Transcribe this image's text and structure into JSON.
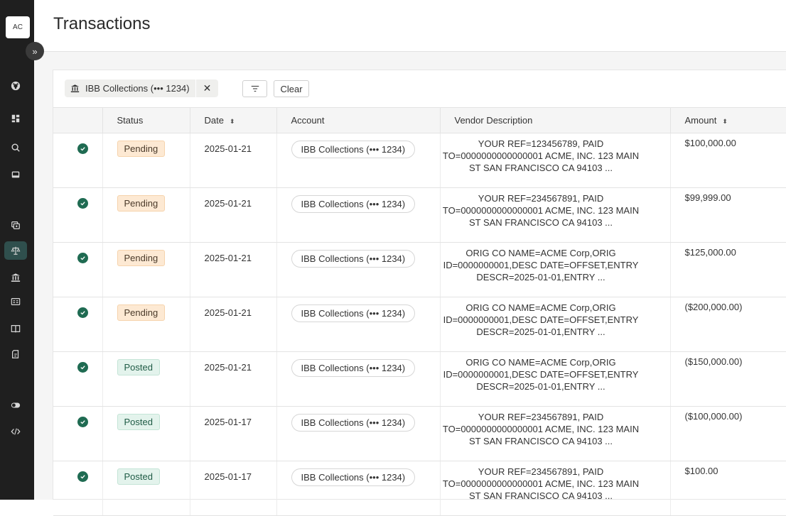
{
  "sidebar": {
    "avatar_initials": "AC",
    "expand_glyph": "»",
    "items": [
      {
        "icon": "life-ring-icon"
      },
      {
        "icon": "dashboard-icon"
      },
      {
        "icon": "search-icon"
      },
      {
        "icon": "inbox-icon"
      },
      {
        "icon": "accounts-icon"
      },
      {
        "icon": "scales-icon",
        "active": true
      },
      {
        "icon": "bank-icon"
      },
      {
        "icon": "id-card-icon"
      },
      {
        "icon": "book-icon"
      },
      {
        "icon": "document-icon"
      },
      {
        "icon": "toggle-icon"
      },
      {
        "icon": "code-icon"
      }
    ]
  },
  "header": {
    "title": "Transactions"
  },
  "filters": {
    "chip_label": "IBB Collections (••• 1234)",
    "chip_close": "✕",
    "clear_label": "Clear"
  },
  "table": {
    "columns": [
      "",
      "Status",
      "Date",
      "Account",
      "Vendor Description",
      "Amount"
    ],
    "sort_glyph": "⬍",
    "rows": [
      {
        "status": "Pending",
        "date": "2025-01-21",
        "account": "IBB Collections (••• 1234)",
        "description": "YOUR REF=123456789, PAID TO=0000000000000001 ACME, INC. 123 MAIN ST SAN FRANCISCO CA 94103 ...",
        "amount": "$100,000.00"
      },
      {
        "status": "Pending",
        "date": "2025-01-21",
        "account": "IBB Collections (••• 1234)",
        "description": "YOUR REF=234567891, PAID TO=0000000000000001 ACME, INC. 123 MAIN ST SAN FRANCISCO CA 94103 ...",
        "amount": "$99,999.00"
      },
      {
        "status": "Pending",
        "date": "2025-01-21",
        "account": "IBB Collections (••• 1234)",
        "description": "ORIG CO NAME=ACME Corp,ORIG ID=0000000001,DESC DATE=OFFSET,ENTRY DESCR=2025-01-01,ENTRY ...",
        "amount": "$125,000.00"
      },
      {
        "status": "Pending",
        "date": "2025-01-21",
        "account": "IBB Collections (••• 1234)",
        "description": "ORIG CO NAME=ACME Corp,ORIG ID=0000000001,DESC DATE=OFFSET,ENTRY DESCR=2025-01-01,ENTRY ...",
        "amount": "($200,000.00)"
      },
      {
        "status": "Posted",
        "date": "2025-01-21",
        "account": "IBB Collections (••• 1234)",
        "description": "ORIG CO NAME=ACME Corp,ORIG ID=0000000001,DESC DATE=OFFSET,ENTRY DESCR=2025-01-01,ENTRY ...",
        "amount": "($150,000.00)"
      },
      {
        "status": "Posted",
        "date": "2025-01-17",
        "account": "IBB Collections (••• 1234)",
        "description": "YOUR REF=234567891, PAID TO=0000000000000001 ACME, INC. 123 MAIN ST SAN FRANCISCO CA 94103 ...",
        "amount": "($100,000.00)"
      },
      {
        "status": "Posted",
        "date": "2025-01-17",
        "account": "IBB Collections (••• 1234)",
        "description": "YOUR REF=234567891, PAID TO=0000000000000001 ACME, INC. 123 MAIN ST SAN FRANCISCO CA 94103 ...",
        "amount": "$100.00"
      }
    ]
  },
  "colors": {
    "sidebar_bg": "#1f1f1f",
    "active_nav": "#2f4f4d",
    "check_green": "#1f6b52",
    "pending_bg": "#fde9d3",
    "posted_bg": "#e3f3ec"
  }
}
